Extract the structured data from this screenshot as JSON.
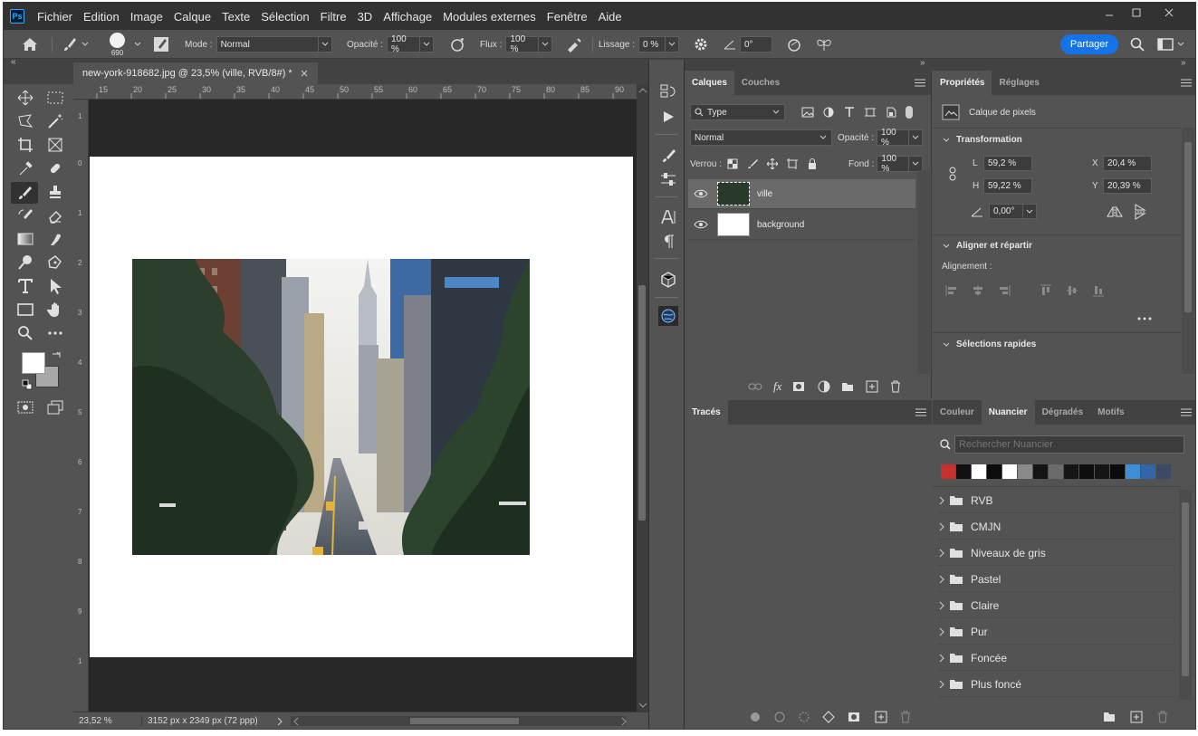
{
  "menu": {
    "logo": "Ps",
    "items": [
      "Fichier",
      "Edition",
      "Image",
      "Calque",
      "Texte",
      "Sélection",
      "Filtre",
      "3D",
      "Affichage",
      "Modules externes",
      "Fenêtre",
      "Aide"
    ]
  },
  "options": {
    "brush_size": "690",
    "mode_label": "Mode :",
    "mode_value": "Normal",
    "opacity_label": "Opacité :",
    "opacity_value": "100 %",
    "flow_label": "Flux :",
    "flow_value": "100 %",
    "smoothing_label": "Lissage :",
    "smoothing_value": "0 %",
    "angle_value": "0°",
    "share_label": "Partager"
  },
  "document": {
    "tab_title": "new-york-918682.jpg @ 23,5% (ville, RVB/8#) *",
    "zoom": "23,52 %",
    "dims": "3152 px x 2349 px (72 ppp)",
    "ruler_top": [
      "15",
      "20",
      "25",
      "30",
      "35",
      "40",
      "45",
      "50",
      "55",
      "60",
      "65",
      "70",
      "75",
      "80",
      "85",
      "90"
    ],
    "ruler_left": [
      "1",
      "0",
      "1",
      "2",
      "3",
      "4",
      "5",
      "6",
      "7",
      "8",
      "9",
      "1"
    ]
  },
  "layers_panel": {
    "tabs": [
      "Calques",
      "Couches"
    ],
    "filter_label": "Type",
    "blend_mode": "Normal",
    "opacity_label": "Opacité :",
    "opacity_value": "100 %",
    "lock_label": "Verrou :",
    "fill_label": "Fond :",
    "fill_value": "100 %",
    "layers": [
      {
        "name": "ville"
      },
      {
        "name": "background"
      }
    ]
  },
  "paths_panel": {
    "tab": "Tracés"
  },
  "properties_panel": {
    "tabs": [
      "Propriétés",
      "Réglages"
    ],
    "kind": "Calque de pixels",
    "transform_title": "Transformation",
    "w_label": "L",
    "w_value": "59,2 %",
    "h_label": "H",
    "h_value": "59,22 %",
    "x_label": "X",
    "x_value": "20,4 %",
    "y_label": "Y",
    "y_value": "20,39 %",
    "angle_value": "0,00°",
    "align_title": "Aligner et répartir",
    "align_sub": "Alignement :",
    "quick_title": "Sélections rapides"
  },
  "swatches_panel": {
    "tabs": [
      "Couleur",
      "Nuancier",
      "Dégradés",
      "Motifs"
    ],
    "search_placeholder": "Rechercher Nuancier",
    "colors": [
      "#c8302c",
      "#111111",
      "#ffffff",
      "#0c0c0c",
      "#ffffff",
      "#8a8a8a",
      "#141414",
      "#6b6b6b",
      "#161616",
      "#0e0e0e",
      "#151515",
      "#0b0b0b",
      "#3d8fd6",
      "#3366a6",
      "#3b4a66"
    ],
    "folders": [
      "RVB",
      "CMJN",
      "Niveaux de gris",
      "Pastel",
      "Claire",
      "Pur",
      "Foncée",
      "Plus foncé"
    ]
  }
}
